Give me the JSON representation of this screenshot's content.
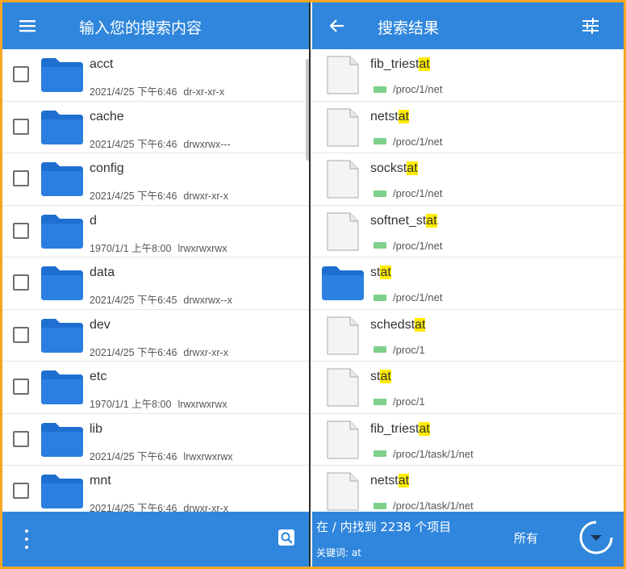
{
  "left": {
    "title": "输入您的搜索内容",
    "items": [
      {
        "name": "acct",
        "date": "2021/4/25 下午6:46",
        "perm": "dr-xr-xr-x"
      },
      {
        "name": "cache",
        "date": "2021/4/25 下午6:46",
        "perm": "drwxrwx---"
      },
      {
        "name": "config",
        "date": "2021/4/25 下午6:46",
        "perm": "drwxr-xr-x"
      },
      {
        "name": "d",
        "date": "1970/1/1 上午8:00",
        "perm": "lrwxrwxrwx"
      },
      {
        "name": "data",
        "date": "2021/4/25 下午6:45",
        "perm": "drwxrwx--x"
      },
      {
        "name": "dev",
        "date": "2021/4/25 下午6:46",
        "perm": "drwxr-xr-x"
      },
      {
        "name": "etc",
        "date": "1970/1/1 上午8:00",
        "perm": "lrwxrwxrwx"
      },
      {
        "name": "lib",
        "date": "2021/4/25 下午6:46",
        "perm": "lrwxrwxrwx"
      },
      {
        "name": "mnt",
        "date": "2021/4/25 下午6:46",
        "perm": "drwxr-xr-x"
      }
    ]
  },
  "right": {
    "title": "搜索结果",
    "results": [
      {
        "pre": "fib_triest",
        "match": "at",
        "post": "",
        "path": "/proc/1/net",
        "type": "file"
      },
      {
        "pre": "netst",
        "match": "at",
        "post": "",
        "path": "/proc/1/net",
        "type": "file"
      },
      {
        "pre": "sockst",
        "match": "at",
        "post": "",
        "path": "/proc/1/net",
        "type": "file"
      },
      {
        "pre": "softnet_st",
        "match": "at",
        "post": "",
        "path": "/proc/1/net",
        "type": "file"
      },
      {
        "pre": "st",
        "match": "at",
        "post": "",
        "path": "/proc/1/net",
        "type": "folder"
      },
      {
        "pre": "schedst",
        "match": "at",
        "post": "",
        "path": "/proc/1",
        "type": "file"
      },
      {
        "pre": "st",
        "match": "at",
        "post": "",
        "path": "/proc/1",
        "type": "file"
      },
      {
        "pre": "fib_triest",
        "match": "at",
        "post": "",
        "path": "/proc/1/task/1/net",
        "type": "file"
      },
      {
        "pre": "netst",
        "match": "at",
        "post": "",
        "path": "/proc/1/task/1/net",
        "type": "file"
      }
    ],
    "status": {
      "found": "在 / 内找到 2238 个项目",
      "keyword": "关键词: at",
      "scope": "所有"
    }
  },
  "icons": {
    "menu": "menu-icon",
    "back": "arrow-left-icon",
    "filter": "tune-icon",
    "more": "more-vert-icon",
    "search": "search-icon",
    "loading": "spinner-icon"
  },
  "colors": {
    "primary": "#2f86dc",
    "folder": "#1e6fd0",
    "highlight": "#ffeb00",
    "drive": "#7fd08a",
    "border": "#f5a623"
  }
}
